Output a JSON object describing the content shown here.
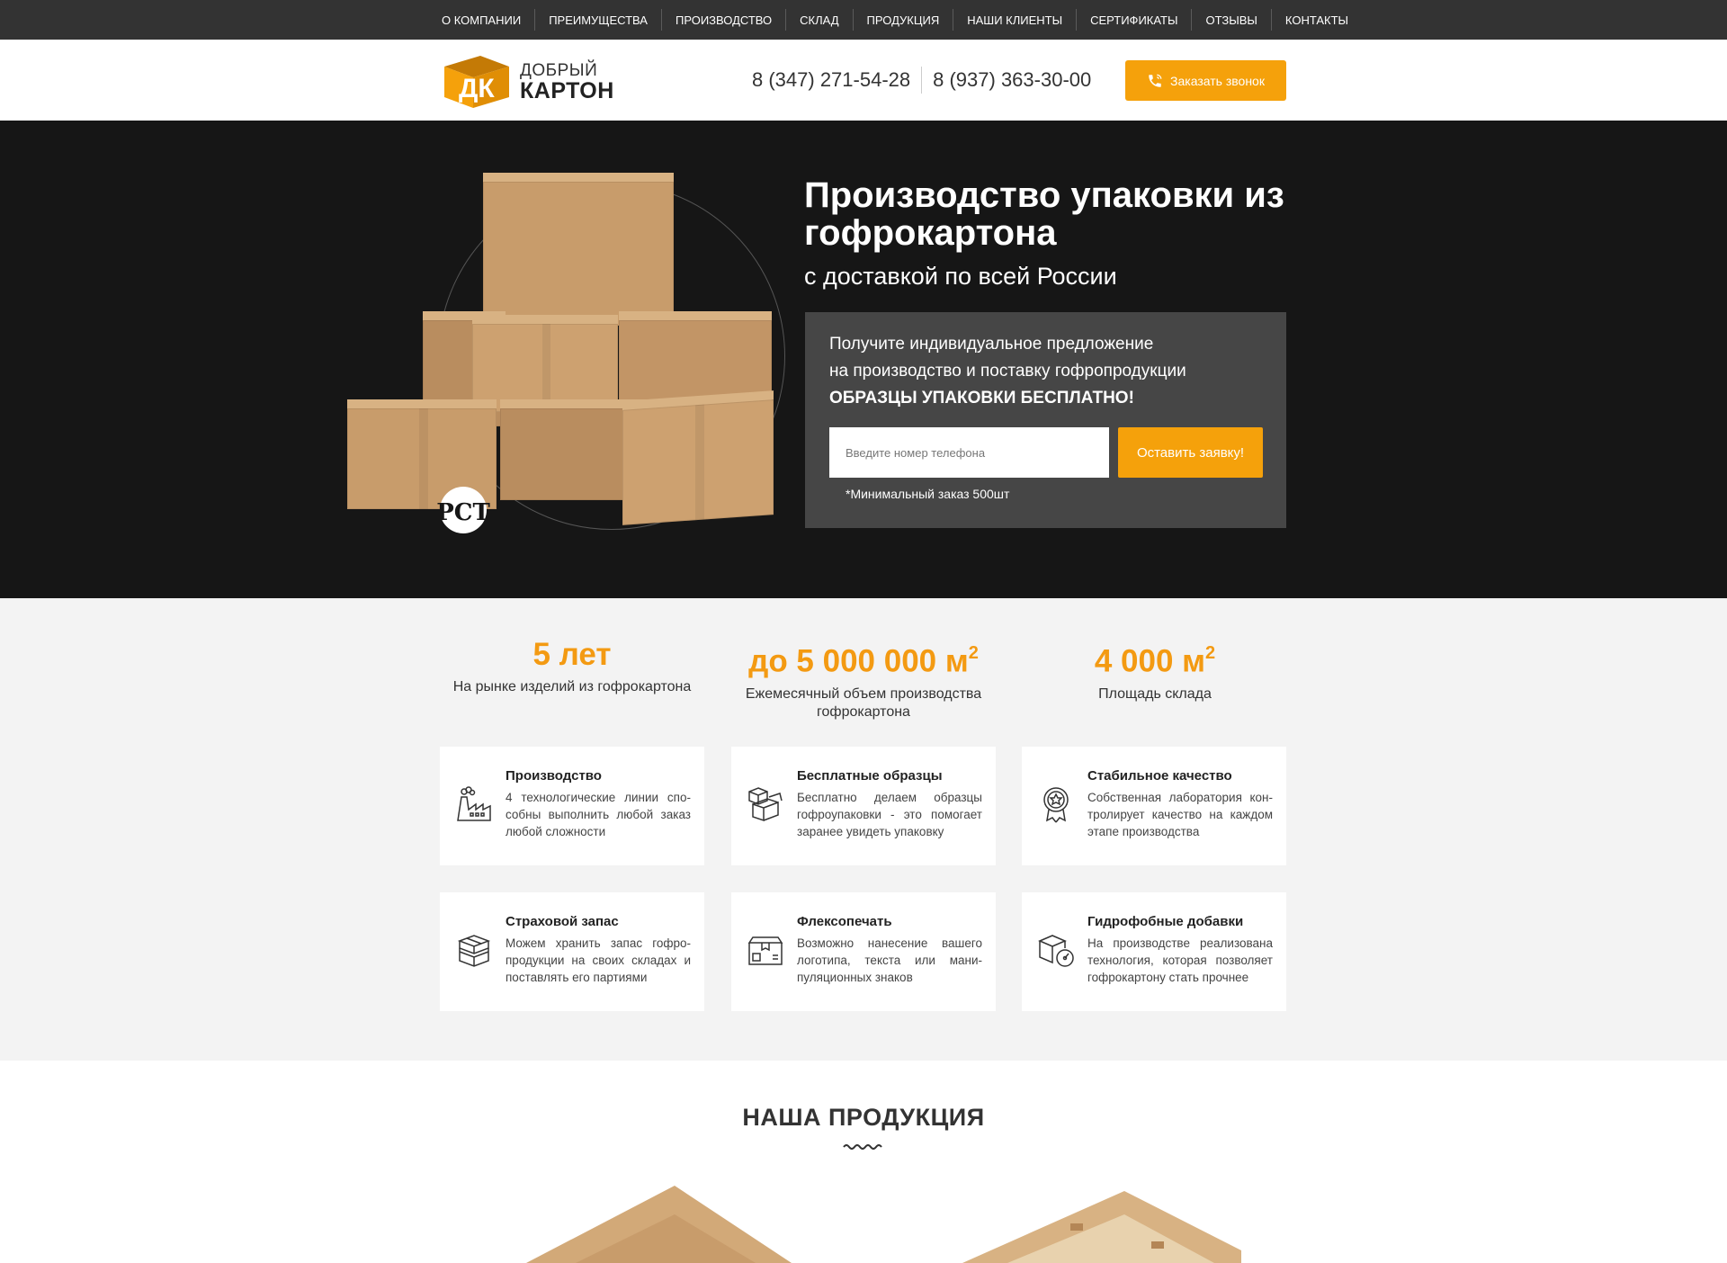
{
  "nav": {
    "items": [
      "О КОМПАНИИ",
      "ПРЕИМУЩЕСТВА",
      "ПРОИЗВОДСТВО",
      "СКЛАД",
      "ПРОДУКЦИЯ",
      "НАШИ КЛИЕНТЫ",
      "СЕРТИФИКАТЫ",
      "ОТЗЫВЫ",
      "КОНТАКТЫ"
    ]
  },
  "header": {
    "logo_line1": "ДОБРЫЙ",
    "logo_line2": "КАРТОН",
    "logo_mark": "ДК",
    "phone1": "8 (347) 271-54-28",
    "phone2": "8 (937) 363-30-00",
    "callback_label": "Заказать звонок",
    "callback_icon": "phone-icon"
  },
  "hero": {
    "title": "Производство упаковки из гофрокартона",
    "subtitle": "с доставкой по всей России",
    "certification_mark": "РСТ",
    "offer": {
      "line1": "Получите индивидуальное предложение",
      "line2": "на производство и поставку гофропродукции",
      "line3": "ОБРАЗЦЫ УПАКОВКИ БЕСПЛАТНО!",
      "input_placeholder": "Введите номер телефона",
      "submit_label": "Оставить заявку!",
      "note": "*Минимальный заказ 500шт"
    }
  },
  "stats": [
    {
      "value": "5 лет",
      "sup": "",
      "label": "На рынке изделий из гофрокартона"
    },
    {
      "value": "до 5 000 000 м",
      "sup": "2",
      "label": "Ежемесячный объем производства гофрокартона"
    },
    {
      "value": "4 000 м",
      "sup": "2",
      "label": "Площадь склада"
    }
  ],
  "features": [
    {
      "title": "Производство",
      "text": "4 технологические линии спо-собны выполнить любой заказ любой сложности",
      "icon": "factory-icon"
    },
    {
      "title": "Бесплатные образцы",
      "text": "Бесплатно делаем образцы гофроупаковки - это помогает заранее увидеть упаковку",
      "icon": "boxes-icon"
    },
    {
      "title": "Стабильное качество",
      "text": "Собственная лаборатория кон-тролирует качество на каждом этапе производства",
      "icon": "quality-badge-icon"
    },
    {
      "title": "Страховой запас",
      "text": "Можем хранить запас гофро-продукции на своих складах и поставлять его партиями",
      "icon": "box-stack-icon"
    },
    {
      "title": "Флексопечать",
      "text": "Возможно нанесение вашего логотипа, текста или мани-пуляционных знаков",
      "icon": "printed-box-icon"
    },
    {
      "title": "Гидрофобные добавки",
      "text": "На производстве реализована технология, которая позволяет гофрокартону стать прочнее",
      "icon": "box-gauge-icon"
    }
  ],
  "colors": {
    "accent": "#f5a10b",
    "nav_bg": "#333333",
    "hero_bg": "#161616",
    "offer_bg": "#464646",
    "stat_color": "#f39a12",
    "features_bg": "#f3f3f3"
  },
  "products": {
    "title": "НАША ПРОДУКЦИЯ"
  }
}
